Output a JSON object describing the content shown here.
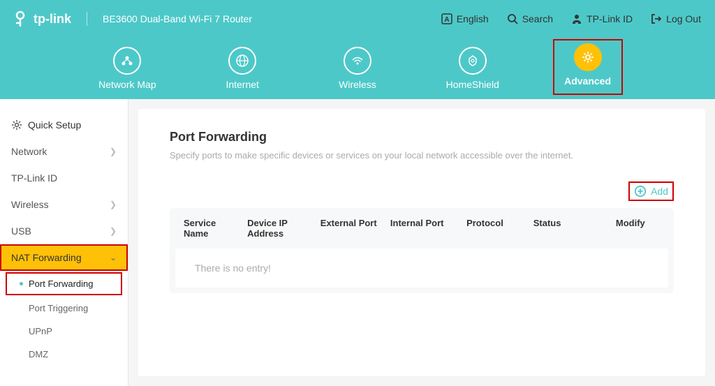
{
  "brand": "tp-link",
  "product": "BE3600 Dual-Band Wi-Fi 7 Router",
  "headerLinks": {
    "lang": "English",
    "search": "Search",
    "tplinkid": "TP-Link ID",
    "logout": "Log Out"
  },
  "nav": {
    "map": "Network Map",
    "internet": "Internet",
    "wireless": "Wireless",
    "homeshield": "HomeShield",
    "advanced": "Advanced"
  },
  "sidebar": {
    "quicksetup": "Quick Setup",
    "network": "Network",
    "tplinkid": "TP-Link ID",
    "wireless": "Wireless",
    "usb": "USB",
    "natfwd": "NAT Forwarding",
    "sub": {
      "portfwd": "Port Forwarding",
      "porttrig": "Port Triggering",
      "upnp": "UPnP",
      "dmz": "DMZ"
    }
  },
  "page": {
    "title": "Port Forwarding",
    "desc": "Specify ports to make specific devices or services on your local network accessible over the internet.",
    "addBtn": "Add",
    "cols": {
      "service": "Service Name",
      "deviceip": "Device IP Address",
      "extport": "External Port",
      "intport": "Internal Port",
      "protocol": "Protocol",
      "status": "Status",
      "modify": "Modify"
    },
    "empty": "There is no entry!"
  }
}
